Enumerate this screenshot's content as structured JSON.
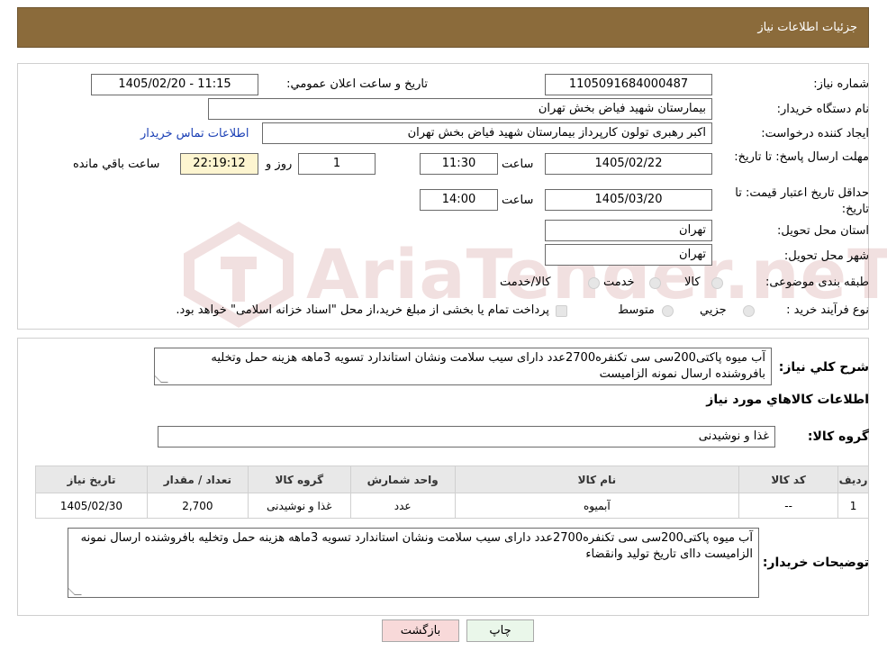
{
  "header": {
    "title": "جزئیات اطلاعات نیاز"
  },
  "form": {
    "need_number_label": "شماره نیاز:",
    "need_number": "1105091684000487",
    "announce_label": "تاریخ و ساعت اعلان عمومي:",
    "announce_value": "1405/02/20 - 11:15",
    "buyer_org_label": "نام دستگاه خريدار:",
    "buyer_org": "بیمارستان شهید فیاض بخش تهران",
    "creator_label": "ايجاد كننده درخواست:",
    "creator": "اکبر رهبری تولون کارپرداز بیمارستان شهید فیاض بخش تهران",
    "contact_link": "اطلاعات تماس خريدار",
    "deadline_label": "مهلت ارسال پاسخ: تا تاريخ:",
    "deadline_date": "1405/02/22",
    "time_label": "ساعت",
    "deadline_time": "11:30",
    "days_value": "1",
    "days_label": "روز و",
    "remaining_value": "22:19:12",
    "remaining_label": "ساعت باقي مانده",
    "validity_label": "حداقل تاريخ اعتبار قيمت: تا تاريخ:",
    "validity_date": "1405/03/20",
    "validity_time": "14:00",
    "province_label": "استان محل تحويل:",
    "province": "تهران",
    "city_label": "شهر محل تحويل:",
    "city": "تهران",
    "category_label": "طبقه بندی موضوعی:",
    "category_options": [
      "کالا",
      "خدمت",
      "کالا/خدمت"
    ],
    "process_label": "نوع فرآيند خريد :",
    "process_options": [
      "جزيي",
      "متوسط"
    ],
    "payment_note": "پرداخت تمام یا بخشی از مبلغ خرید،از محل \"اسناد خزانه اسلامی\" خواهد بود."
  },
  "details": {
    "description_label": "شرح كلي نياز:",
    "description": "آب میوه پاکتی200سی سی تکنفره2700عدد دارای سیب سلامت ونشان استاندارد تسویه 3ماهه هزینه حمل وتخلیه بافروشنده ارسال نمونه الزامیست",
    "goods_info_title": "اطلاعات كالاهاي مورد نياز",
    "goods_group_label": "گروه كالا:",
    "goods_group": "غذا و نوشیدنی"
  },
  "table": {
    "headers": [
      "رديف",
      "كد كالا",
      "نام كالا",
      "واحد شمارش",
      "گروه كالا",
      "تعداد / مقدار",
      "تاريخ نياز"
    ],
    "rows": [
      [
        "1",
        "--",
        "آبمیوه",
        "عدد",
        "غذا و نوشیدنی",
        "2,700",
        "1405/02/30"
      ]
    ]
  },
  "buyer_notes": {
    "label": "توضيحات خريدار:",
    "text": "آب میوه پاکتی200سی سی تکنفره2700عدد دارای سیب سلامت ونشان استاندارد تسویه 3ماهه هزینه حمل وتخلیه بافروشنده ارسال نمونه الزامیست  دااى تاریخ تولید وانقضاء"
  },
  "buttons": {
    "print": "چاپ",
    "back": "بازگشت"
  },
  "colors": {
    "header_bg": "#8b6b3b",
    "link": "#1a3fb5",
    "back_btn": "#f8d9d9",
    "print_btn": "#eaf7ea"
  }
}
